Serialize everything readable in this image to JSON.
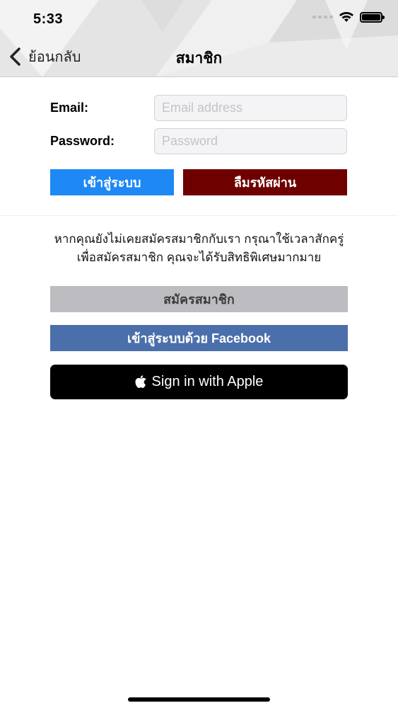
{
  "status_bar": {
    "time": "5:33"
  },
  "nav": {
    "back_label": "ย้อนกลับ",
    "title": "สมาชิก"
  },
  "login_form": {
    "email_label": "Email:",
    "email_placeholder": "Email address",
    "email_value": "",
    "password_label": "Password:",
    "password_placeholder": "Password",
    "password_value": "",
    "login_button": "เข้าสู่ระบบ",
    "forgot_button": "ลืมรหัสผ่าน"
  },
  "register_section": {
    "info_line1": "หากคุณยังไม่เคยสมัครสมาชิกกับเรา กรุณาใช้เวลาสักครู่",
    "info_line2": "เพื่อสมัครสมาชิก คุณจะได้รับสิทธิพิเศษมากมาย",
    "register_button": "สมัครสมาชิก",
    "facebook_button": "เข้าสู่ระบบด้วย Facebook",
    "apple_button": "Sign in with Apple"
  },
  "colors": {
    "login_button": "#1e88f5",
    "forgot_button": "#6e0000",
    "register_button": "#bdbcc1",
    "facebook_button": "#4a6fab",
    "apple_button": "#000000"
  },
  "icons": {
    "back": "chevron-left-icon",
    "apple": "apple-logo-icon",
    "wifi": "wifi-icon",
    "battery": "battery-icon"
  }
}
